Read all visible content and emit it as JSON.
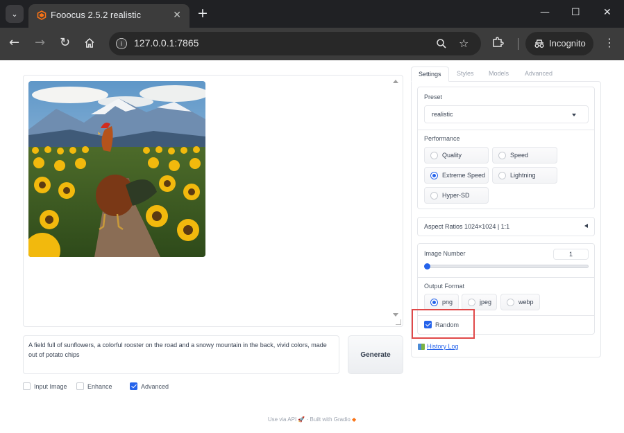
{
  "browser": {
    "tab_title": "Fooocus 2.5.2 realistic",
    "url": "127.0.0.1:7865",
    "incognito_label": "Incognito",
    "accent": "#f97316"
  },
  "prompt": {
    "value": "A field full of sunflowers, a colorful rooster on the road and a snowy mountain in the back, vivid colors, made out of potato chips"
  },
  "generate_label": "Generate",
  "options": {
    "input_image": "Input Image",
    "enhance": "Enhance",
    "advanced": "Advanced"
  },
  "footer": {
    "api": "Use via API",
    "separator": "·",
    "built": "Built with Gradio"
  },
  "tabs": [
    "Settings",
    "Styles",
    "Models",
    "Advanced"
  ],
  "settings": {
    "preset_label": "Preset",
    "preset_value": "realistic",
    "performance_label": "Performance",
    "performance_options": [
      "Quality",
      "Speed",
      "Extreme Speed",
      "Lightning",
      "Hyper-SD"
    ],
    "performance_selected": "Extreme Speed",
    "aspect_ratios": "Aspect Ratios 1024×1024 | 1:1",
    "image_number_label": "Image Number",
    "image_number_value": "1",
    "output_format_label": "Output Format",
    "output_formats": [
      "png",
      "jpeg",
      "webp"
    ],
    "output_format_selected": "png",
    "random_label": "Random",
    "history_log": "History Log"
  }
}
